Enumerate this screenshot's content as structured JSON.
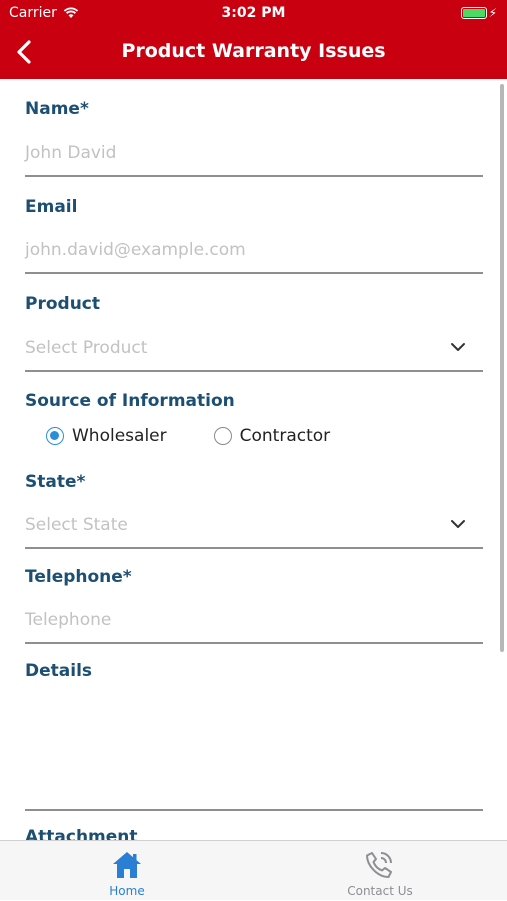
{
  "status_bar": {
    "carrier": "Carrier",
    "time": "3:02 PM"
  },
  "header": {
    "title": "Product Warranty Issues"
  },
  "form": {
    "name": {
      "label": "Name*",
      "placeholder": "John David"
    },
    "email": {
      "label": "Email",
      "placeholder": "john.david@example.com"
    },
    "product": {
      "label": "Product",
      "placeholder": "Select Product"
    },
    "source": {
      "label": "Source of Information",
      "options": [
        {
          "label": "Wholesaler",
          "selected": true
        },
        {
          "label": "Contractor",
          "selected": false
        }
      ]
    },
    "state": {
      "label": "State*",
      "placeholder": "Select State"
    },
    "telephone": {
      "label": "Telephone*",
      "placeholder": "Telephone"
    },
    "details": {
      "label": "Details"
    },
    "attachment": {
      "label": "Attachment"
    }
  },
  "tabbar": {
    "home": {
      "label": "Home",
      "icon": "home-icon",
      "color": "#2a7fd4"
    },
    "contact": {
      "label": "Contact Us",
      "icon": "phone-icon",
      "color": "#8e8e93"
    }
  },
  "colors": {
    "header_bg": "#c8000f",
    "label": "#1d4f73",
    "accent": "#2a8fd7"
  }
}
